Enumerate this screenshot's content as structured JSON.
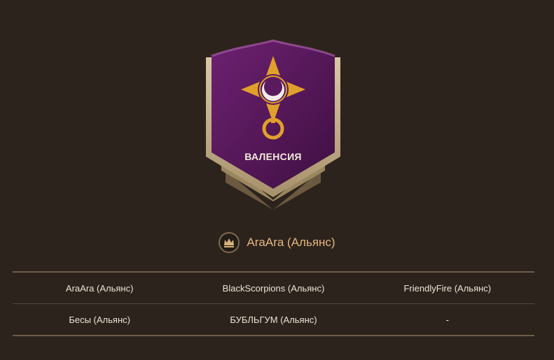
{
  "castle": {
    "name": "ВАЛЕНСИЯ",
    "colors": {
      "banner": "#5e1a62",
      "banner_highlight": "#8b3a90",
      "frame": "#c7b596",
      "emblem": "#e0a02c",
      "moon": "#f2ece8"
    },
    "icon": "crescent-moon-emblem"
  },
  "owner": {
    "name": "AraAra (Альянс)",
    "icon": "crown-emblem-icon"
  },
  "alliances": {
    "rows": [
      [
        "AraAra (Альянс)",
        "BlackScorpions (Альянс)",
        "FriendlyFire (Альянс)"
      ],
      [
        "Бесы (Альянс)",
        "БУБЛЬГУМ (Альянс)",
        "-"
      ]
    ]
  }
}
